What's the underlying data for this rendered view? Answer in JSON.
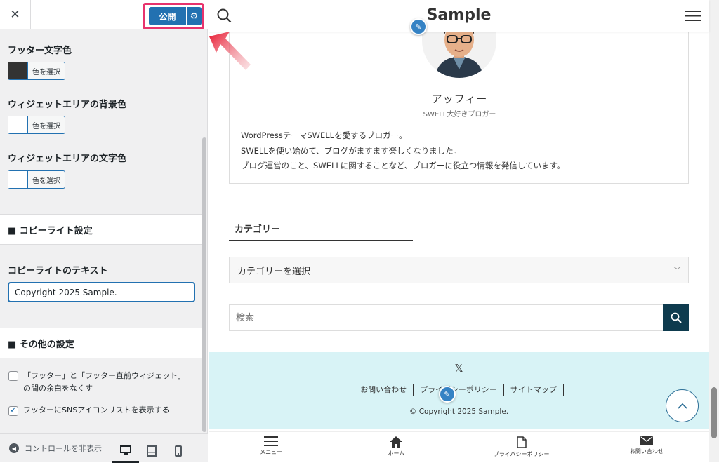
{
  "sidebar": {
    "close_label": "✕",
    "publish_label": "公開",
    "controls": [
      {
        "label": "フッター文字色",
        "button": "色を選択",
        "swatch": "#333333"
      },
      {
        "label": "ウィジェットエリアの背景色",
        "button": "色を選択",
        "swatch": "#ffffff"
      },
      {
        "label": "ウィジェットエリアの文字色",
        "button": "色を選択",
        "swatch": "#ffffff"
      }
    ],
    "section_copyright": "■ コピーライト設定",
    "copyright_label": "コピーライトのテキスト",
    "copyright_value": "Copyright 2025 Sample.",
    "section_other": "■ その他の設定",
    "checkbox1_line1": "「フッター」と「フッター直前ウィジェット」",
    "checkbox1_line2": "の間の余白をなくす",
    "checkbox1_checked": false,
    "checkbox2": "フッターにSNSアイコンリストを表示する",
    "checkbox2_checked": true,
    "hide_controls": "コントロールを非表示",
    "active_device": "desktop"
  },
  "preview": {
    "site_title": "Sample",
    "profile_name": "アッフィー",
    "profile_sub": "SWELL大好きブロガー",
    "profile_desc": [
      "WordPressテーマSWELLを愛するブロガー。",
      "SWELLを使い始めて、ブログがますます楽しくなりました。",
      "ブログ運営のこと、SWELLに関することなど、ブロガーに役立つ情報を発信しています。"
    ],
    "category_title": "カテゴリー",
    "category_select": "カテゴリーを選択",
    "search_placeholder": "検索",
    "footer_sns": "𝕏",
    "footer_nav": [
      "お問い合わせ",
      "プライバシーポリシー",
      "サイトマップ"
    ],
    "copyright": "© Copyright 2025 Sample.",
    "fix_menu": [
      {
        "label": "メニュー",
        "icon": "menu-icon"
      },
      {
        "label": "ホーム",
        "icon": "home-icon"
      },
      {
        "label": "プライバシーポリシー",
        "icon": "document-icon"
      },
      {
        "label": "お問い合わせ",
        "icon": "mail-icon"
      }
    ]
  },
  "colors": {
    "accent": "#2271b1",
    "highlight": "#e8336d",
    "footer_bg": "#d8f3f6",
    "search_btn": "#0e3b4e"
  }
}
